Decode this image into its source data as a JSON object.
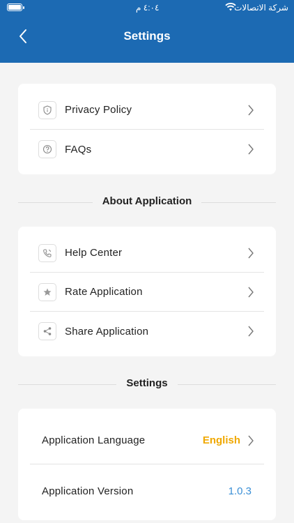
{
  "status_bar": {
    "time": "٤:٠٤ م",
    "carrier": "شركة الاتصالات"
  },
  "header": {
    "title": "Settings"
  },
  "group1": {
    "items": [
      {
        "label": "Privacy Policy",
        "icon": "shield-info-icon"
      },
      {
        "label": "FAQs",
        "icon": "question-icon"
      }
    ]
  },
  "about_section": {
    "title": "About Application",
    "items": [
      {
        "label": "Help Center",
        "icon": "phone-icon"
      },
      {
        "label": "Rate Application",
        "icon": "star-icon"
      },
      {
        "label": "Share Application",
        "icon": "share-icon"
      }
    ]
  },
  "settings_section": {
    "title": "Settings",
    "language_label": "Application Language",
    "language_value": "English",
    "version_label": "Application Version",
    "version_value": "1.0.3"
  },
  "colors": {
    "header_bg": "#1c6ab3",
    "accent_language": "#f0a800",
    "version_color": "#3a8fd6"
  }
}
